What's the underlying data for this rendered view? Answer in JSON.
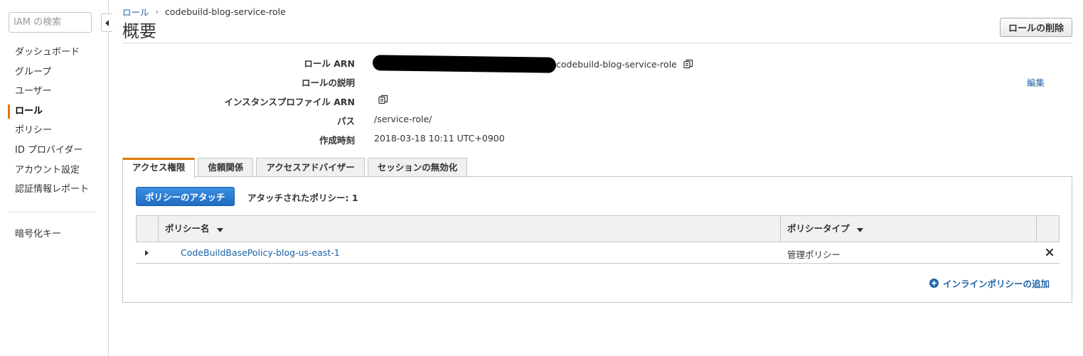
{
  "sidebar": {
    "search_placeholder": "IAM の検索",
    "items": [
      {
        "label": "ダッシュボード"
      },
      {
        "label": "グループ"
      },
      {
        "label": "ユーザー"
      },
      {
        "label": "ロール",
        "active": true
      },
      {
        "label": "ポリシー"
      },
      {
        "label": "ID プロバイダー"
      },
      {
        "label": "アカウント設定"
      },
      {
        "label": "認証情報レポート"
      }
    ],
    "encryption_item": "暗号化キー"
  },
  "breadcrumb": {
    "parent": "ロール",
    "current": "codebuild-blog-service-role"
  },
  "page_title": "概要",
  "delete_button": "ロールの削除",
  "summary": {
    "role_arn_label": "ロール ARN",
    "role_arn_visible_suffix": "codebuild-blog-service-role",
    "description_label": "ロールの説明",
    "edit_link": "編集",
    "instance_profile_label": "インスタンスプロファイル ARN",
    "path_label": "パス",
    "path_value": "/service-role/",
    "created_label": "作成時刻",
    "created_value": "2018-03-18 10:11 UTC+0900"
  },
  "tabs": [
    {
      "label": "アクセス権限",
      "active": true
    },
    {
      "label": "信頼関係"
    },
    {
      "label": "アクセスアドバイザー"
    },
    {
      "label": "セッションの無効化"
    }
  ],
  "permissions": {
    "attach_button": "ポリシーのアタッチ",
    "attached_count_text": "アタッチされたポリシー: 1",
    "columns": [
      "ポリシー名",
      "ポリシータイプ"
    ],
    "rows": [
      {
        "name": "CodeBuildBasePolicy-blog-us-east-1",
        "type": "管理ポリシー"
      }
    ],
    "add_inline": "インラインポリシーの追加"
  },
  "colors": {
    "accent": "#e07a00",
    "link": "#1e62a6",
    "primary_button": "#1f6dc4"
  }
}
